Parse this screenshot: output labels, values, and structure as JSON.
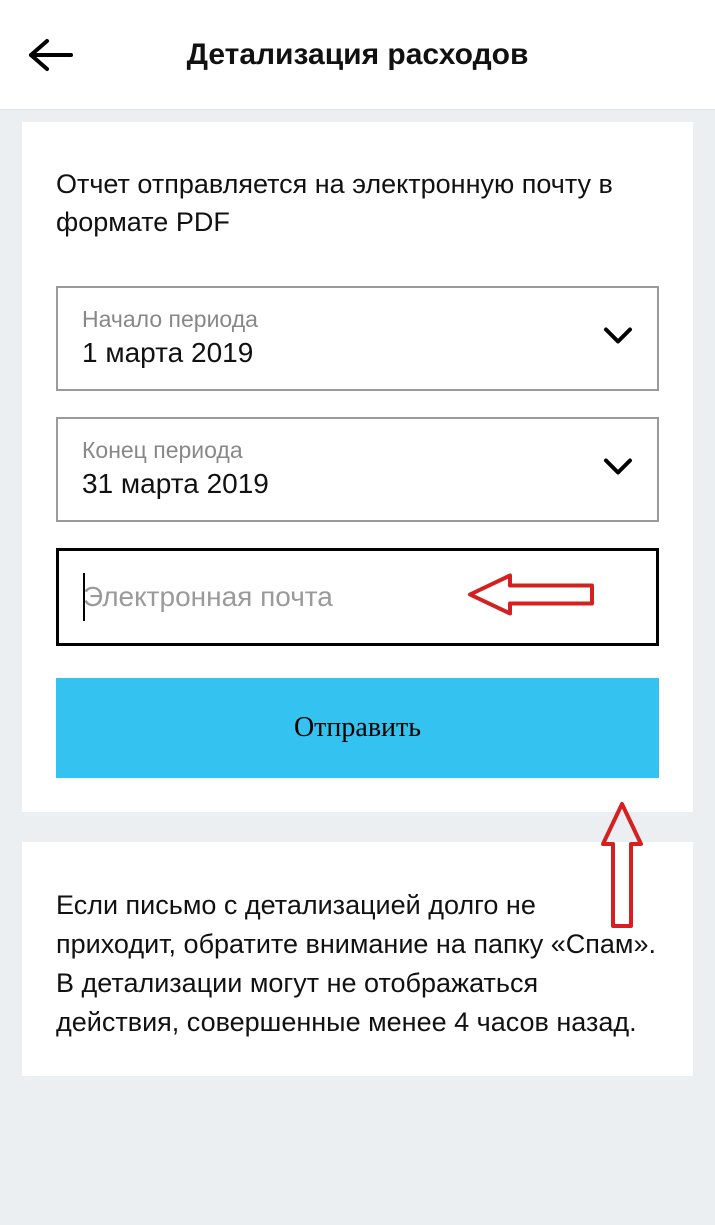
{
  "header": {
    "title": "Детализация расходов"
  },
  "form": {
    "intro": "Отчет отправляется на электронную почту в формате PDF",
    "start": {
      "label": "Начало периода",
      "value": "1 марта 2019"
    },
    "end": {
      "label": "Конец периода",
      "value": "31 марта 2019"
    },
    "email": {
      "placeholder": "Электронная почта",
      "value": ""
    },
    "submit_label": "Отправить"
  },
  "note": {
    "text": "Если письмо с детализацией долго не приходит, обратите внимание на папку «Спам». В детализации могут не отображаться действия, совершенные менее 4 часов назад."
  }
}
